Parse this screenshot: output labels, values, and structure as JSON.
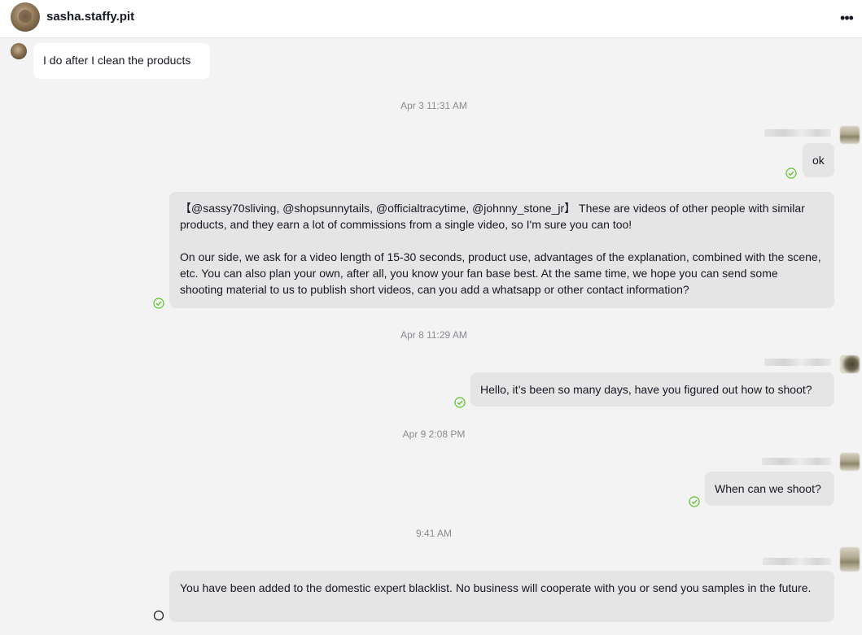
{
  "header": {
    "username": "sasha.staffy.pit",
    "more_icon": "more-horizontal-icon",
    "more_glyph": "•••"
  },
  "messages": [
    {
      "id": "m1",
      "direction": "incoming",
      "text": "I do after I clean the products"
    },
    {
      "id": "t1",
      "type": "timestamp",
      "text": "Apr 3 11:31 AM"
    },
    {
      "id": "m2",
      "direction": "outgoing",
      "text": "ok",
      "status": "read"
    },
    {
      "id": "m3",
      "direction": "outgoing",
      "paragraphs": [
        "【@sassy70sliving, @shopsunnytails, @officialtracytime, @johnny_stone_jr】 These are videos of other people with similar products, and they earn a lot of commissions from a single video, so I'm sure you can too!",
        "On our side, we ask for a video length of 15-30 seconds, product use, advantages of the explanation, combined with the scene, etc. You can also plan your own, after all, you know your fan base best. At the same time, we hope you can send some shooting material to us to publish short videos, can you add a whatsapp or other contact information?"
      ],
      "status": "read"
    },
    {
      "id": "t2",
      "type": "timestamp",
      "text": "Apr 8 11:29 AM"
    },
    {
      "id": "m4",
      "direction": "outgoing",
      "text": "Hello, it’s been so many days, have you figured out how to shoot?",
      "status": "read"
    },
    {
      "id": "t3",
      "type": "timestamp",
      "text": "Apr 9 2:08 PM"
    },
    {
      "id": "m5",
      "direction": "outgoing",
      "text": "When can we shoot?",
      "status": "read"
    },
    {
      "id": "t4",
      "type": "timestamp",
      "text": "9:41 AM"
    },
    {
      "id": "m6",
      "direction": "outgoing",
      "text": "You have been added to the domestic expert blacklist. No business will cooperate with you or send you samples in the future.",
      "status": "sent"
    }
  ],
  "colors": {
    "incoming_bubble": "#ffffff",
    "outgoing_bubble": "#e5e5e5",
    "read_check": "#58c322",
    "background": "#f3f3f3"
  },
  "icons": {
    "read": "check-circle-icon",
    "sent": "empty-circle-icon"
  }
}
